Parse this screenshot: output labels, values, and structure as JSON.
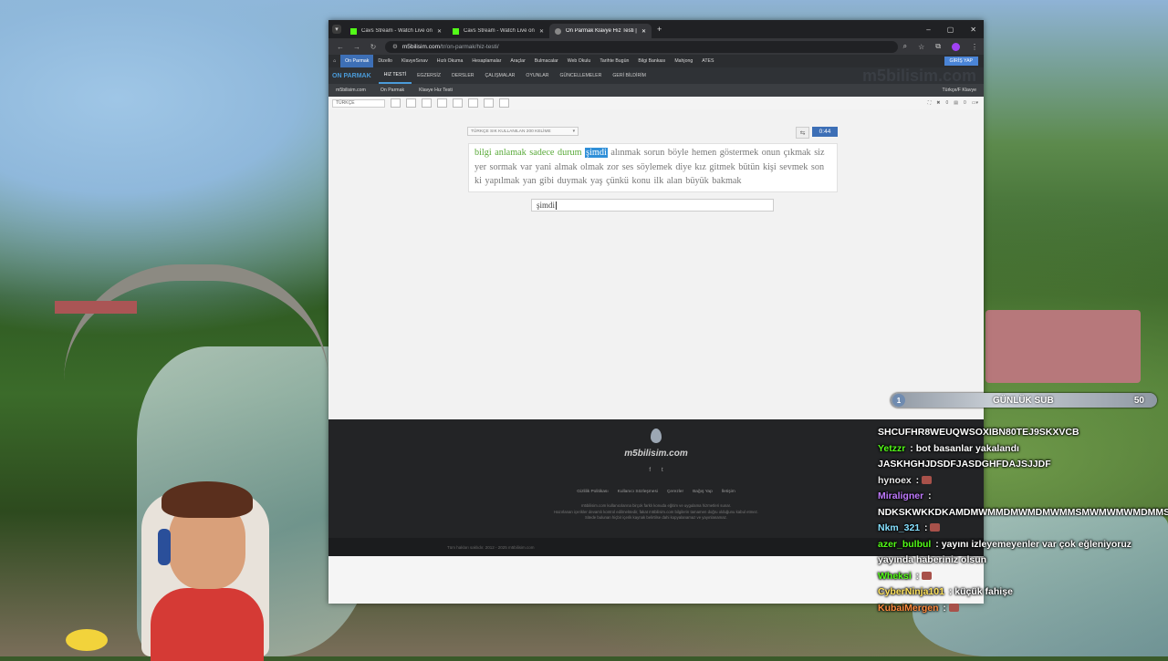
{
  "browser": {
    "tabs": [
      {
        "title": "Cavs Stream - Watch Live on Kick"
      },
      {
        "title": "Cavs Stream - Watch Live on Kick"
      },
      {
        "title": "On Parmak Klavye Hız Testi | m5bilisim.com"
      }
    ],
    "url_host": "m5bilisim.com",
    "url_path": "/tr/on-parmak/hiz-testi/"
  },
  "site": {
    "menu": [
      "On Parmak",
      "Dizello",
      "KlavyeSınav",
      "Hızlı Okuma",
      "Hesaplamalar",
      "Araçlar",
      "Bulmacalar",
      "Web Okulu",
      "Tarihte Bugün",
      "Bilgi Bankası",
      "Mahjong",
      "ATES"
    ],
    "login": "GİRİŞ YAP",
    "brand": "ON PARMAK",
    "submenu": [
      "HIZ TESTİ",
      "EGZERSİZ",
      "DERSLER",
      "ÇALIŞMALAR",
      "OYUNLAR",
      "GÜNCELLEMELER",
      "GERİ BİLDİRİM"
    ],
    "watermark": "m5bilisim.com",
    "crumbs": [
      "m5bilisim.com",
      "On Parmak",
      "Klavye Hız Testi"
    ],
    "keyboard": "Türkçe/F Klavye",
    "language": "TÜRKÇE",
    "toolbar_counts": [
      "0",
      "0"
    ]
  },
  "test": {
    "word_set": "TÜRKÇE SIK KULLANILAN 200 KELİME",
    "timer": "0:44",
    "done_words": "bilgi anlamak sadece durum",
    "current_word": "şimdi",
    "remaining_words": "alınmak sorun böyle hemen göstermek onun çıkmak siz yer sormak var yani almak olmak zor ses söylemek diye kız gitmek bütün kişi sevmek son ki yapılmak yan gibi duymak yaş çünkü konu ilk alan büyük bakmak",
    "input_value": "şimdi"
  },
  "footer": {
    "name": "m5bilisim.com",
    "social": [
      "f",
      "t"
    ],
    "links": [
      "Gizlilik Politikası",
      "Kullanıcı Sözleşmesi",
      "Çerezler",
      "Bağış Yap",
      "İletişim"
    ],
    "disclaimer": [
      "m5bilisim.com kullanıcılarına birçok farklı konuda eğitim ve uygulama hizmetleri sunar.",
      "Hazırlanan içerikler devamlı kontrol edilmektedir, fakat m5bilisim.com bilgilerin tamamen doğru olduğunu kabul etmez.",
      "Sitede bulunan hiçbir içerik kaynak belirtilse dahi kopyalanamaz ve yayınlanamaz."
    ],
    "copyright": "Tüm hakları saklıdır. 2012 - 2025 m5bilisim.com"
  },
  "overlay": {
    "sub_goal": {
      "level": "1",
      "title": "GÜNLÜK SUB",
      "goal": "50",
      "progress": 0.02
    },
    "chat": [
      {
        "name": "",
        "text": "SHCUFHR8WEUQWSOXIBN80TEJ9SKXVCB",
        "color": "#ffffff"
      },
      {
        "name": "Yetzzr",
        "text": "bot basanlar yakalandı JASKHGHJDSDFJASDGHFDAJSJJDF",
        "color": "#53fc18"
      },
      {
        "name": "hynoex",
        "text": "",
        "color": "#e8e8e8"
      },
      {
        "name": "Miraligner",
        "text": "NDKSKWKKDKAMDMWMMDMWMDMWMMSMWMWMWMDMMS",
        "color": "#c07aff"
      },
      {
        "name": "Nkm_321",
        "text": "",
        "color": "#86e0ff"
      },
      {
        "name": "azer_bulbul",
        "text": "yayını izleyemeyenler var çok eğleniyoruz yayında haberiniz olsun",
        "color": "#53fc18"
      },
      {
        "name": "Wheksi",
        "text": "",
        "color": "#53fc18"
      },
      {
        "name": "CyberNinja101",
        "text": "küçük fahişe",
        "color": "#ffe35c"
      },
      {
        "name": "KubaiMergen",
        "text": "",
        "color": "#ff8a3d"
      }
    ]
  }
}
